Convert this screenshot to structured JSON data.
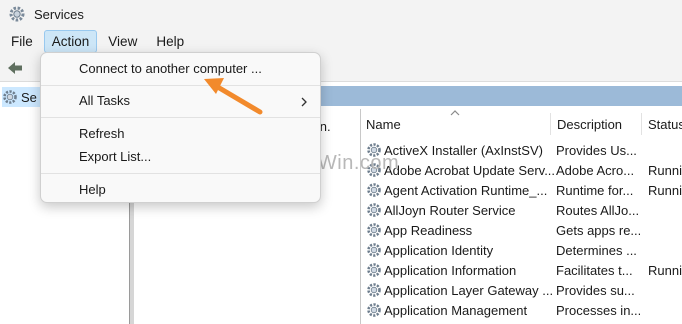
{
  "window": {
    "title": "Services"
  },
  "menubar": {
    "items": [
      "File",
      "Action",
      "View",
      "Help"
    ],
    "active": "Action"
  },
  "tree": {
    "item_label": "Se"
  },
  "main": {
    "description_snippet": "tion.",
    "columns": {
      "name": "Name",
      "description": "Description",
      "status": "Status"
    },
    "rows": [
      {
        "name": "ActiveX Installer (AxInstSV)",
        "description": "Provides Us...",
        "status": ""
      },
      {
        "name": "Adobe Acrobat Update Serv...",
        "description": "Adobe Acro...",
        "status": "Runni"
      },
      {
        "name": "Agent Activation Runtime_...",
        "description": "Runtime for...",
        "status": "Runni"
      },
      {
        "name": "AllJoyn Router Service",
        "description": "Routes AllJo...",
        "status": ""
      },
      {
        "name": "App Readiness",
        "description": "Gets apps re...",
        "status": ""
      },
      {
        "name": "Application Identity",
        "description": "Determines ...",
        "status": ""
      },
      {
        "name": "Application Information",
        "description": "Facilitates t...",
        "status": "Runni"
      },
      {
        "name": "Application Layer Gateway ...",
        "description": "Provides su...",
        "status": ""
      },
      {
        "name": "Application Management",
        "description": "Processes in...",
        "status": ""
      }
    ]
  },
  "action_menu": {
    "connect": "Connect to another computer ...",
    "all_tasks": "All Tasks",
    "refresh": "Refresh",
    "export_list": "Export List...",
    "help": "Help"
  },
  "watermark": "RepairWin.com",
  "colors": {
    "menu_active": "#cde6f7",
    "header_band": "#9cbad8",
    "annotation_arrow": "#f28a2c"
  },
  "icons": {
    "app": "services-gear-icon",
    "row": "service-gear-icon",
    "submenu": "chevron-right-icon"
  }
}
